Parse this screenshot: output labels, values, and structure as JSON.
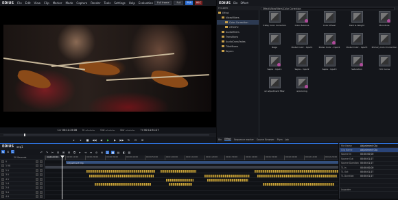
{
  "left_menu": {
    "logo": "EDIUS",
    "items": [
      "File",
      "Edit",
      "View",
      "Clip",
      "Marker",
      "Mode",
      "Capture",
      "Render",
      "Tools",
      "Settings",
      "Help",
      "Evaluation"
    ]
  },
  "top_right": {
    "dropdown1": "Full frame",
    "dropdown2": "Full",
    "badge": "PLR",
    "badge2": "REC"
  },
  "viewer": {
    "cur_label": "Cur",
    "cur_value": "00:11:15:08",
    "in_label": "In",
    "in_value": "--:--:--:--",
    "out_label": "Out",
    "out_value": "--:--:--:--",
    "dur_label": "Dur",
    "dur_value": "--:--:--:--",
    "ttl_label": "Ttl",
    "ttl_value": "00:11:51:27"
  },
  "transport_icons": [
    "mark-in",
    "mark-out",
    "stop",
    "rewind",
    "step-back",
    "play",
    "step-forward",
    "fast-forward",
    "loop",
    "insert",
    "overwrite"
  ],
  "right_menu": {
    "logo": "EDIUS",
    "items": [
      "Bin",
      "Effect"
    ]
  },
  "folder_label": "FOLDER",
  "breadcrumb": "Effect\\VideoFilters\\Color Correction",
  "tree": [
    {
      "label": "Effect",
      "indent": 0
    },
    {
      "label": "VideoFilters",
      "indent": 1
    },
    {
      "label": "Color Correction",
      "indent": 2,
      "selected": true
    },
    {
      "label": "GPUSFX",
      "indent": 2
    },
    {
      "label": "AudioFilters",
      "indent": 1
    },
    {
      "label": "Transitions",
      "indent": 1
    },
    {
      "label": "AudioCrossFades",
      "indent": 1
    },
    {
      "label": "TitleMixers",
      "indent": 1
    },
    {
      "label": "Keyers",
      "indent": 1
    }
  ],
  "effects": [
    "3-Way Color Correction",
    "Color Balance",
    "Color Wheel",
    "Dark & Weight",
    "Monotone",
    "Nega",
    "Poster Color - Input1",
    "Poster Color - Input2",
    "Poster Color - Input3",
    "Primary Color Correction",
    "Sepia - Input1",
    "Sepia - Input2",
    "Sepia - Input3",
    "Saturation",
    "YUV Curve",
    "w/ adjustment filter",
    "w/coloring"
  ],
  "panel_tabs": [
    "Bin",
    "Effect",
    "Sequence marker",
    "Source Browser",
    "Plym",
    "Job"
  ],
  "timeline": {
    "logo": "EDIUS",
    "sequence": "seq1",
    "sequence_tab": "sequence1",
    "header_label": "20 Seconds"
  },
  "timecodes": [
    "00:00:00:00",
    "00:00:10:00",
    "00:00:20:00",
    "00:00:30:00",
    "00:00:40:00",
    "00:00:50:00",
    "00:01:00:00",
    "00:01:10:00",
    "00:01:20:00",
    "00:01:30:00",
    "00:01:40:00",
    "00:01:50:00",
    "00:02:00:00",
    "00:02:10:00",
    "00:02:20:00"
  ],
  "tracks": [
    "V",
    "1 VA",
    "2 V",
    "3 V",
    "4 V",
    "1 A",
    "2 A",
    "3 A",
    "4 A"
  ],
  "adjustment_clip": "Adjustment Clip",
  "properties": [
    {
      "k": "File Name",
      "v": "Adjustment Clip"
    },
    {
      "k": "Clip Name",
      "v": "Adjustment Clip"
    },
    {
      "k": "Source In",
      "v": "00:00:00;00"
    },
    {
      "k": "Source Out",
      "v": "00:00:01;27"
    },
    {
      "k": "Source Duration",
      "v": "00:00:01;27"
    },
    {
      "k": "TL In",
      "v": "00:00:00;00"
    },
    {
      "k": "TL Out",
      "v": "00:00:01;27"
    },
    {
      "k": "TL Duration",
      "v": "00:00:01;27"
    },
    {
      "k": "",
      "v": ""
    },
    {
      "k": "",
      "v": ""
    },
    {
      "k": "Layouter",
      "v": ""
    }
  ],
  "colors": {
    "accent": "#2d6fd6",
    "audio": "#c8a23a",
    "badge": "#b04a9a"
  }
}
